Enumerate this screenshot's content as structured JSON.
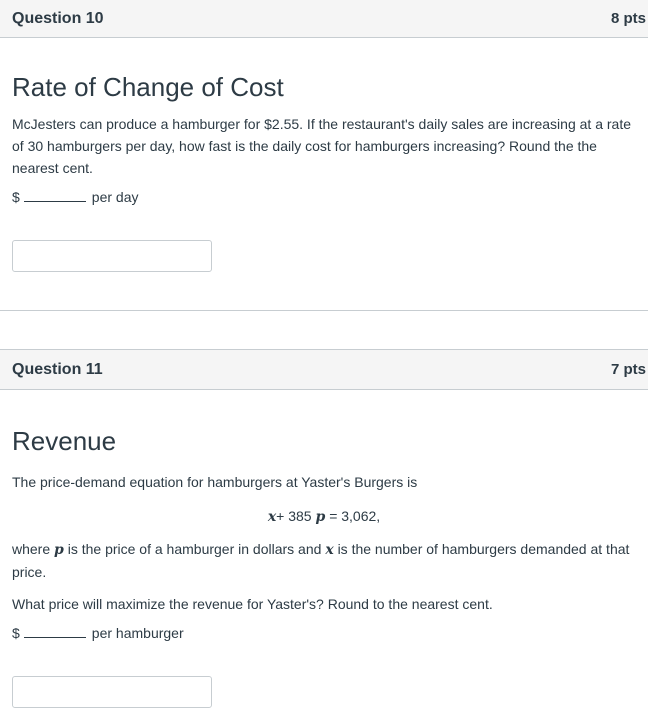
{
  "questions": [
    {
      "title": "Question 10",
      "points": "8 pts",
      "heading": "Rate of Change of Cost",
      "paragraph": "McJesters can produce a hamburger for $2.55.  If the restaurant's daily sales are increasing at a rate of 30 hamburgers per day, how fast is the daily cost for hamburgers increasing?  Round the the nearest cent.",
      "answer_prefix": "$",
      "answer_suffix": "per day"
    },
    {
      "title": "Question 11",
      "points": "7 pts",
      "heading": "Revenue",
      "intro": "The price-demand equation for hamburgers at Yaster's Burgers is",
      "equation": {
        "var_x": "x",
        "plus": "+ 385",
        "var_p": "p",
        "rhs": "= 3,062,"
      },
      "where": {
        "w1": "where",
        "var_p": "p",
        "w2": "is the price of a hamburger in dollars and",
        "var_x": "x",
        "w3": "is the number of hamburgers demanded at that price."
      },
      "prompt": "What price will maximize the revenue for Yaster's?  Round to the nearest cent.",
      "answer_prefix": "$",
      "answer_suffix": "per hamburger"
    }
  ]
}
